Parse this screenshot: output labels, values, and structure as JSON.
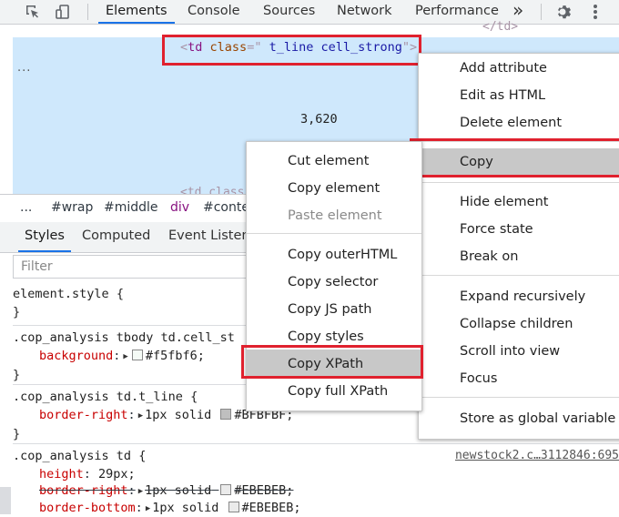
{
  "toolbar": {
    "tabs": [
      "Elements",
      "Console",
      "Sources",
      "Network",
      "Performance"
    ],
    "overflow_glyph": "»",
    "active_tab": "Elements"
  },
  "tree": {
    "prev_line": "</td>",
    "selected_line": {
      "open": "<",
      "tag": "td",
      "attr": "class",
      "eq": "=\"",
      "value": " t_line cell_strong",
      "close": "\">"
    },
    "cell_value": "3,620",
    "next_line": "<td class",
    "dots": "..."
  },
  "breadcrumbs": [
    "...",
    "#wrap",
    "#middle",
    "div",
    "#conte"
  ],
  "styles_tabs": [
    "Styles",
    "Computed",
    "Event Listene"
  ],
  "filter_placeholder": "Filter",
  "rules": {
    "r0": {
      "selector": "element.style",
      "open": "{",
      "close": "}"
    },
    "r1": {
      "selector": ".cop_analysis tbody td.cell_st",
      "prop": "background",
      "colon": ":",
      "value": "#f5fbf6;",
      "close": "}"
    },
    "r2": {
      "selector": ".cop_analysis td.t_line",
      "open": "{",
      "prop": "border-right",
      "colon": ":",
      "value_pre": "1px solid",
      "value": "#BFBFBF;",
      "close": "}"
    },
    "r3": {
      "selector": ".cop_analysis td",
      "open": "{",
      "source": "newstock2.c…3112846:695",
      "p1": "height",
      "v1": "29px;",
      "p2": "border-right",
      "v2_pre": "1px solid",
      "v2": "#EBEBEB;",
      "p3": "border-bottom",
      "v3_pre": "1px solid",
      "v3": "#EBEBEB;"
    }
  },
  "colors": {
    "swatch_r1": "#f5fbf6",
    "swatch_r2": "#BFBFBF",
    "swatch_r3": "#EBEBEB",
    "highlight": "#e0212e",
    "accent": "#1a73e8"
  },
  "main_menu": {
    "items": [
      "Add attribute",
      "Edit as HTML",
      "Delete element",
      "Copy",
      "Hide element",
      "Force state",
      "Break on",
      "Expand recursively",
      "Collapse children",
      "Scroll into view",
      "Focus",
      "Store as global variable"
    ]
  },
  "copy_menu": {
    "items": [
      "Cut element",
      "Copy element",
      "Paste element",
      "Copy outerHTML",
      "Copy selector",
      "Copy JS path",
      "Copy styles",
      "Copy XPath",
      "Copy full XPath"
    ]
  }
}
